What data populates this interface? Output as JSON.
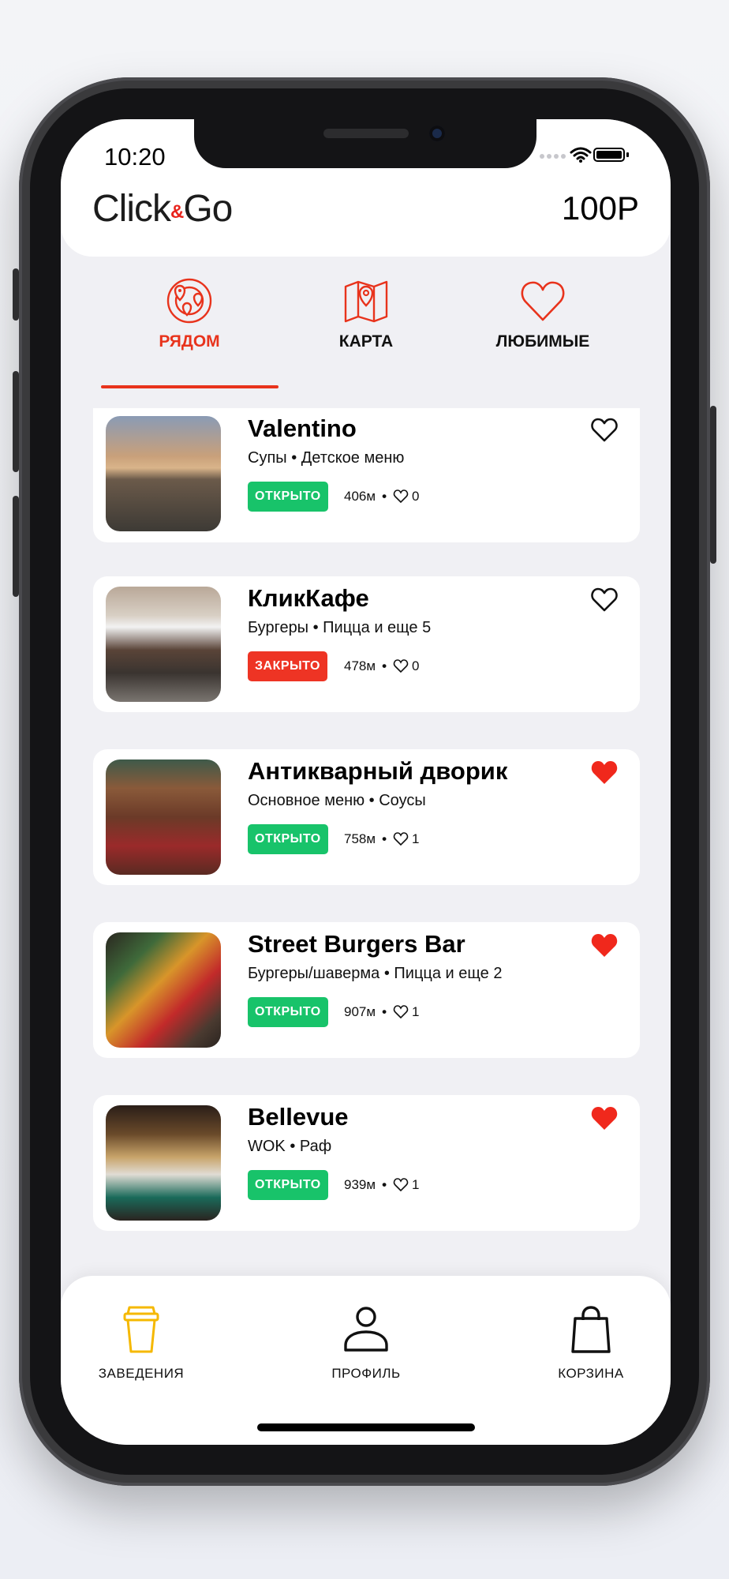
{
  "status_bar": {
    "time": "10:20"
  },
  "header": {
    "logo_left": "Click",
    "logo_amp": "&",
    "logo_right": "Go",
    "balance": "100Р"
  },
  "tabs": [
    {
      "label": "РЯДОМ",
      "icon": "nearby-radar-icon",
      "active": true
    },
    {
      "label": "КАРТА",
      "icon": "map-pin-icon",
      "active": false
    },
    {
      "label": "ЛЮБИМЫЕ",
      "icon": "heart-outline-icon",
      "active": false
    }
  ],
  "places": [
    {
      "name": "Valentino",
      "categories": "Супы • Детское меню",
      "status": "ОТКРЫТО",
      "open": true,
      "distance": "406м",
      "likes": "0",
      "favorite": false
    },
    {
      "name": "КликКафе",
      "categories": "Бургеры • Пицца и еще 5",
      "status": "ЗАКРЫТО",
      "open": false,
      "distance": "478м",
      "likes": "0",
      "favorite": false
    },
    {
      "name": "Антикварный дворик",
      "categories": "Основное меню • Соусы",
      "status": "ОТКРЫТО",
      "open": true,
      "distance": "758м",
      "likes": "1",
      "favorite": true
    },
    {
      "name": "Street Burgers Bar",
      "categories": "Бургеры/шаверма • Пицца и еще 2",
      "status": "ОТКРЫТО",
      "open": true,
      "distance": "907м",
      "likes": "1",
      "favorite": true
    },
    {
      "name": "Bellevue",
      "categories": "WOK • Раф",
      "status": "ОТКРЫТО",
      "open": true,
      "distance": "939м",
      "likes": "1",
      "favorite": true
    }
  ],
  "bottom_nav": [
    {
      "label": "ЗАВЕДЕНИЯ",
      "icon": "coffee-cup-icon",
      "active": true
    },
    {
      "label": "ПРОФИЛЬ",
      "icon": "profile-icon",
      "active": false
    },
    {
      "label": "КОРЗИНА",
      "icon": "shopping-bag-icon",
      "active": false
    }
  ],
  "colors": {
    "accent": "#e8331c",
    "open": "#18c36a",
    "closed": "#ee3424",
    "nav_active": "#f5b800"
  }
}
